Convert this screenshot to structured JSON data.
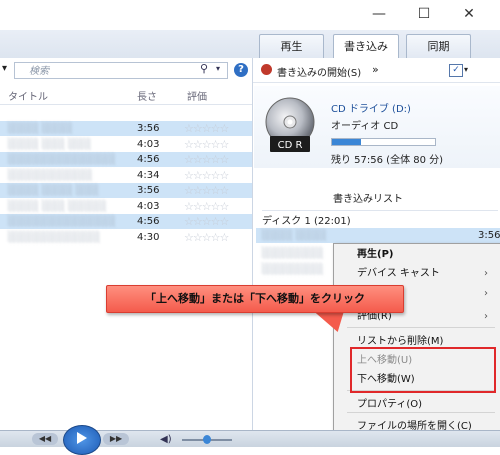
{
  "window": {
    "minimize": "—",
    "maximize": "☐",
    "close": "✕"
  },
  "tabs": [
    "再生",
    "書き込み",
    "同期"
  ],
  "active_tab": 1,
  "search": {
    "placeholder": "検索"
  },
  "left_columns": {
    "title": "タイトル",
    "length": "長さ",
    "rating": "評価"
  },
  "tracks": [
    {
      "title": "░░░░ ░░░░",
      "length": "3:56",
      "selected": true
    },
    {
      "title": "░░░░ ░░░ ░░░",
      "length": "4:03",
      "selected": false
    },
    {
      "title": "░░░░░░░░░░░░░░",
      "length": "4:56",
      "selected": true
    },
    {
      "title": "░░░░░░░░░░░",
      "length": "4:34",
      "selected": false
    },
    {
      "title": "░░░░ ░░░░ ░░░",
      "length": "3:56",
      "selected": true
    },
    {
      "title": "░░░░ ░░░ ░░░░░",
      "length": "4:03",
      "selected": false
    },
    {
      "title": "░░░░░░░░░░░░░░",
      "length": "4:56",
      "selected": true
    },
    {
      "title": "░░░░░░░░░░░░",
      "length": "4:30",
      "selected": false
    }
  ],
  "rating_stars": "☆☆☆☆☆",
  "burn": {
    "start_label": "書き込みの開始(S)",
    "more": "»",
    "cd_drive": "CD ドライブ (D:)",
    "cd_type": "オーディオ CD",
    "remaining": "残り 57:56 (全体 80 分)",
    "progress_fraction": 0.28,
    "cd_label": "CD R",
    "list_title": "書き込みリスト",
    "disc": "ディスク 1 (22:01)",
    "first_item": "░░░░ ░░░░",
    "first_item_length": "3:56"
  },
  "context_menu": {
    "items": [
      {
        "label": "再生(P)",
        "bold": true,
        "disabled": false,
        "submenu": false
      },
      {
        "label": "デバイス キャスト",
        "disabled": false,
        "submenu": true
      },
      {
        "label": "",
        "disabled": false,
        "submenu": true
      },
      {
        "label": "評価(R)",
        "disabled": false,
        "submenu": true
      },
      {
        "label": "リストから削除(M)",
        "disabled": false,
        "submenu": false
      },
      {
        "label": "上へ移動(U)",
        "disabled": true,
        "submenu": false
      },
      {
        "label": "下へ移動(W)",
        "disabled": false,
        "submenu": false
      },
      {
        "label": "プロパティ(O)",
        "disabled": false,
        "submenu": false
      },
      {
        "label": "ファイルの場所を開く(C)",
        "disabled": false,
        "submenu": false
      }
    ]
  },
  "callout": "「上へ移動」または「下へ移動」をクリック",
  "colors": {
    "accent": "#3b86d6",
    "highlight": "#e0282a",
    "callout": "#f45b4c",
    "selected_row": "#cde3f7"
  }
}
